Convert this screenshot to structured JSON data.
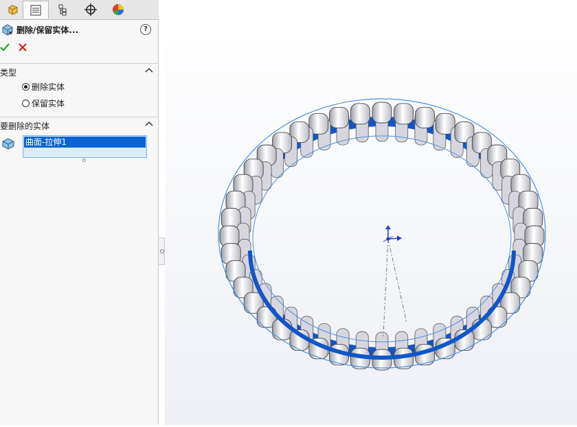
{
  "panel": {
    "tabs": [
      {
        "name": "feature-manager",
        "icon": "feature-tree-icon"
      },
      {
        "name": "property-manager",
        "icon": "property-manager-icon"
      },
      {
        "name": "configuration-manager",
        "icon": "configuration-manager-icon"
      },
      {
        "name": "dimxpert-manager",
        "icon": "crosshair-icon"
      },
      {
        "name": "display-manager",
        "icon": "display-pie-icon"
      }
    ],
    "title": "删除/保留实体...",
    "help_icon": "?",
    "colors": {
      "ok": "#2f9e2f",
      "cancel": "#d02020",
      "selection": "#0a64d6"
    },
    "type_section": {
      "title": "类型",
      "options": [
        {
          "label": "删除实体",
          "selected": true
        },
        {
          "label": "保留实体",
          "selected": false
        }
      ]
    },
    "bodies_section": {
      "title": "要删除的实体",
      "items": [
        "曲面-拉伸1"
      ]
    }
  }
}
